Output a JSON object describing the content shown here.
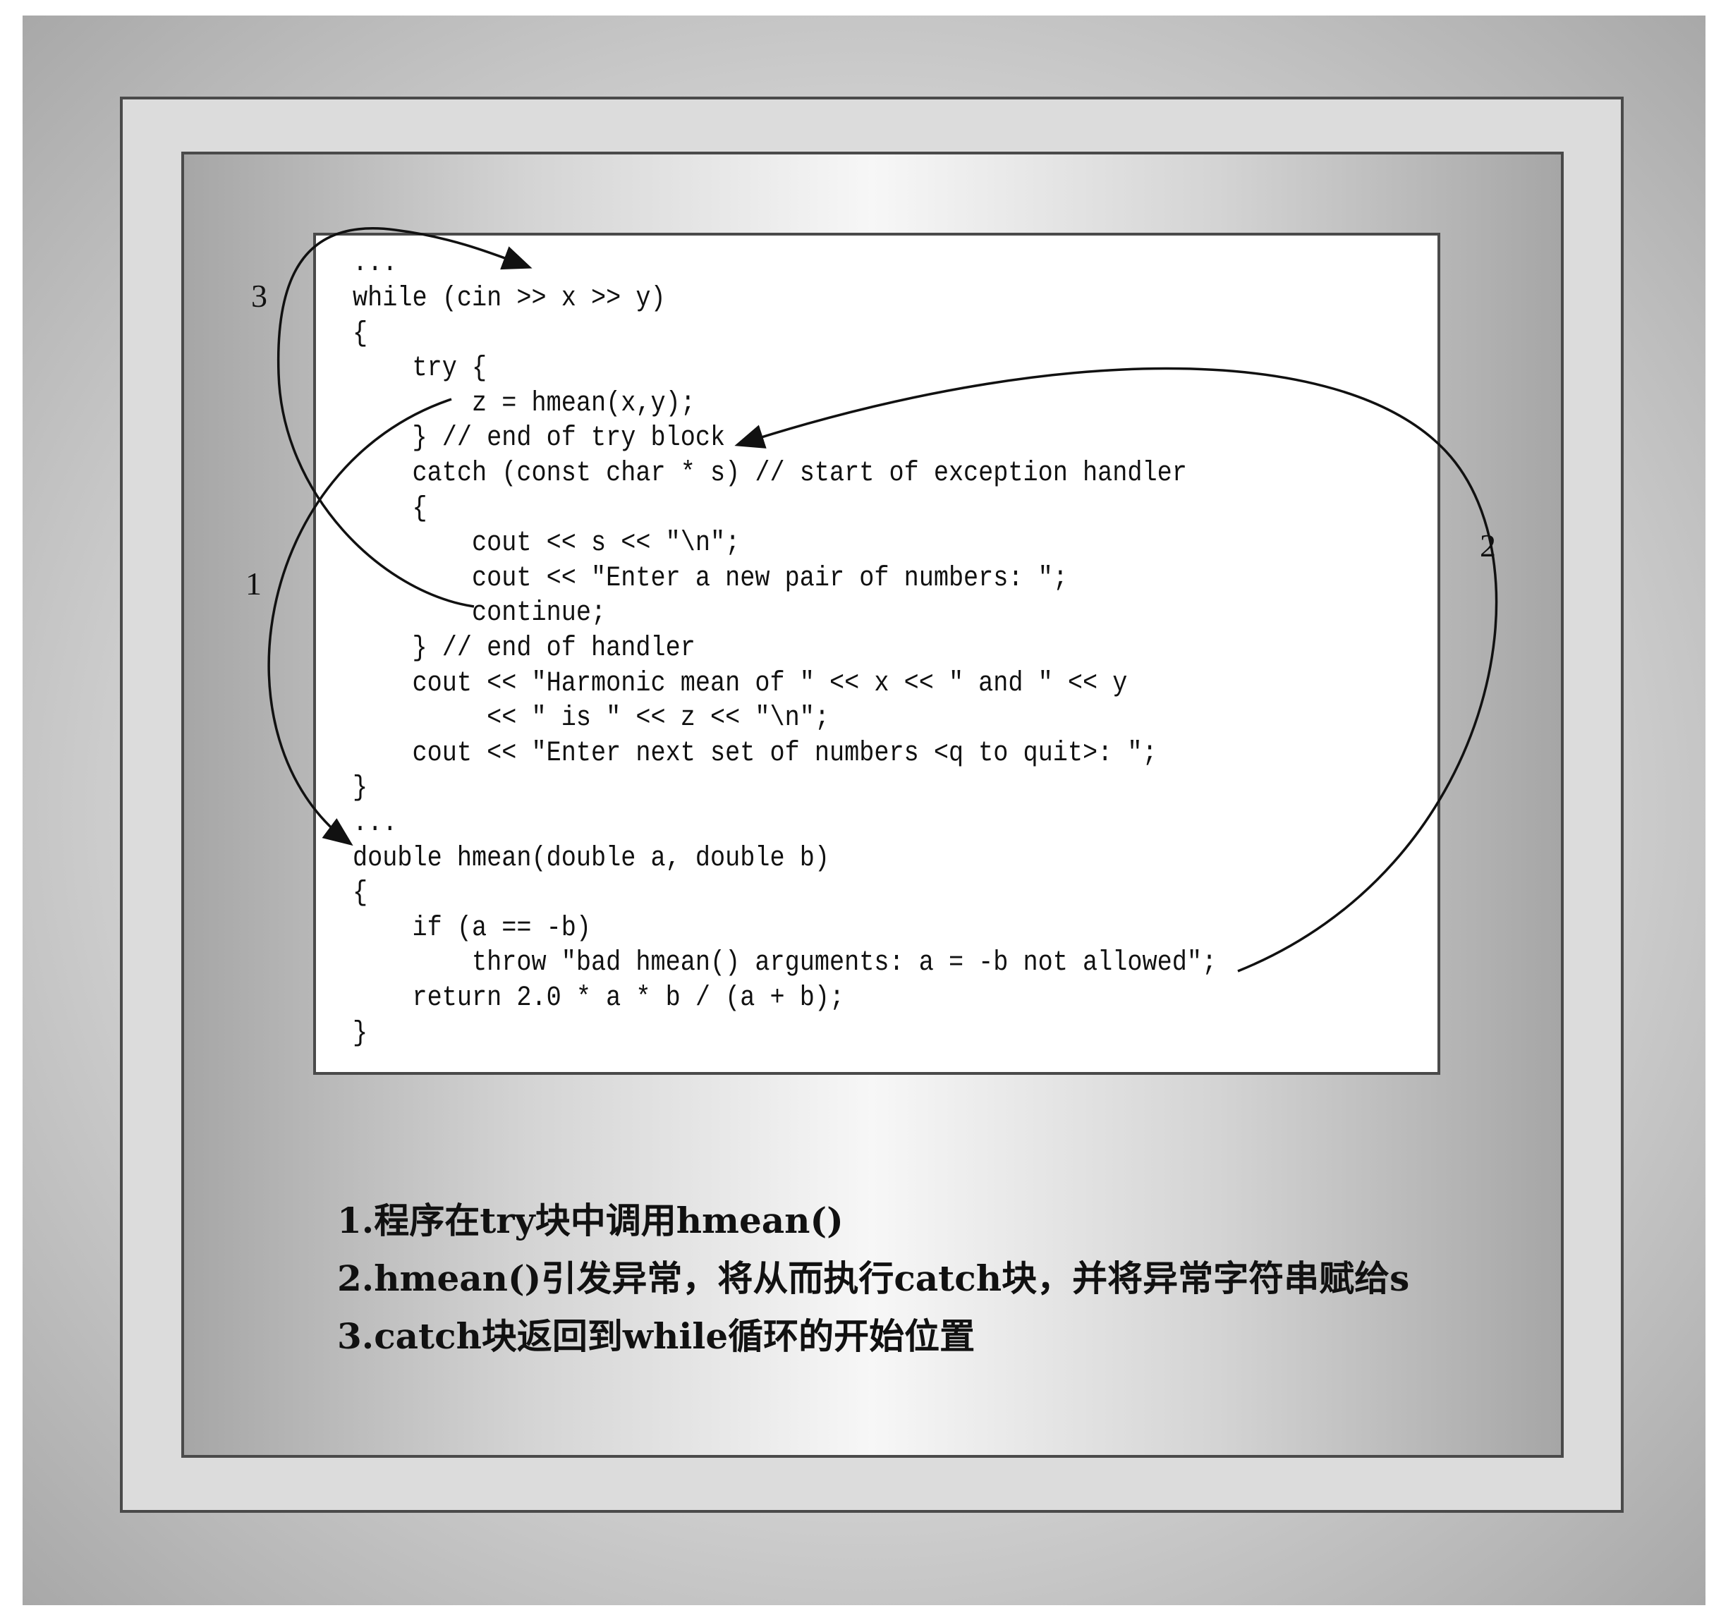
{
  "code_lines": [
    "...",
    "while (cin >> x >> y)",
    "{",
    "    try {",
    "        z = hmean(x,y);",
    "    } // end of try block",
    "    catch (const char * s) // start of exception handler",
    "    {",
    "        cout << s << \"\\n\";",
    "        cout << \"Enter a new pair of numbers: \";",
    "        continue;",
    "    } // end of handler",
    "    cout << \"Harmonic mean of \" << x << \" and \" << y",
    "         << \" is \" << z << \"\\n\";",
    "    cout << \"Enter next set of numbers <q to quit>: \";",
    "}",
    "...",
    "double hmean(double a, double b)",
    "{",
    "    if (a == -b)",
    "        throw \"bad hmean() arguments: a = -b not allowed\";",
    "    return 2.0 * a * b / (a + b);",
    "}"
  ],
  "flow_labels": {
    "step1": "1",
    "step2": "2",
    "step3": "3"
  },
  "notes": [
    "1.程序在try块中调用hmean()",
    "2.hmean()引发异常，将从而执行catch块，并将异常字符串赋给s",
    "3.catch块返回到while循环的开始位置"
  ]
}
